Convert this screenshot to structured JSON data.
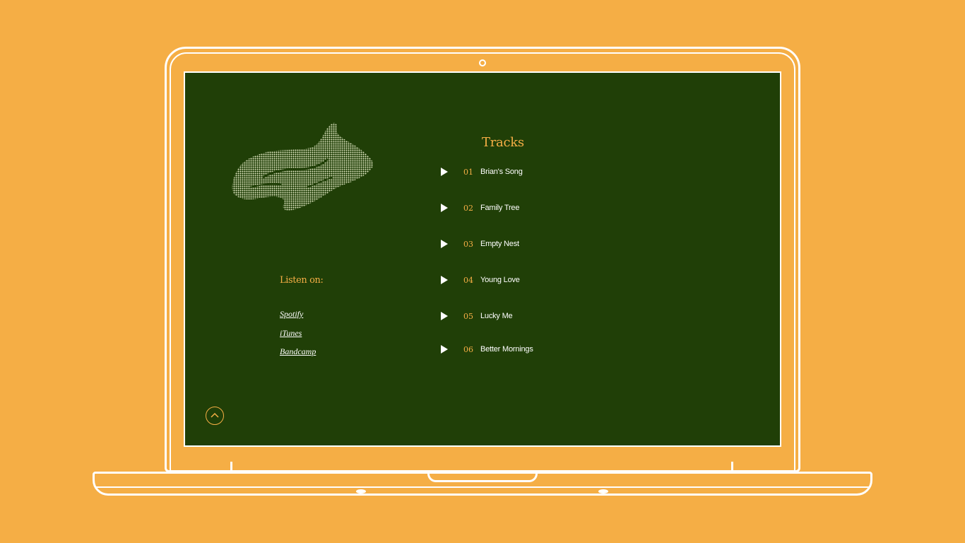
{
  "tracks_section": {
    "title": "Tracks",
    "items": [
      {
        "number": "01",
        "name": "Brian's Song"
      },
      {
        "number": "02",
        "name": "Family Tree"
      },
      {
        "number": "03",
        "name": "Empty Nest"
      },
      {
        "number": "04",
        "name": "Young Love"
      },
      {
        "number": "05",
        "name": "Lucky Me"
      },
      {
        "number": "06",
        "name": "Better Mornings"
      }
    ]
  },
  "listen": {
    "label": "Listen on:",
    "services": [
      "Spotify",
      "iTunes",
      "Bandcamp"
    ]
  },
  "icons": {
    "play": "play-icon",
    "back_to_top": "chevron-up-icon",
    "artwork": "fish-illustration"
  },
  "colors": {
    "background": "#f5ae45",
    "screen": "#203f07",
    "accent": "#f5ae45",
    "text": "#ffffff"
  }
}
